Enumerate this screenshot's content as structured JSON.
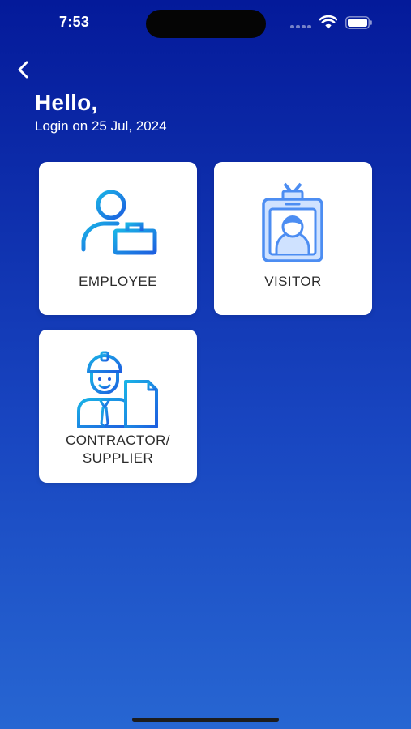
{
  "status_bar": {
    "time": "7:53",
    "icons": [
      "signal-icon",
      "wifi-icon",
      "battery-icon"
    ]
  },
  "header": {
    "back_icon": "chevron-left-icon",
    "greeting": "Hello,",
    "login_date": "Login on 25 Jul, 2024"
  },
  "cards": [
    {
      "label": "EMPLOYEE",
      "icon": "employee-id-icon"
    },
    {
      "label": "VISITOR",
      "icon": "visitor-badge-icon"
    },
    {
      "label": "CONTRACTOR/\nSUPPLIER",
      "icon": "contractor-worker-icon"
    }
  ],
  "colors": {
    "background_top": "#041a9a",
    "background_bottom": "#2766d2",
    "card_background": "#ffffff",
    "label_text": "#2b2b2b",
    "icon_gradient_start": "#1ab3e6",
    "icon_gradient_end": "#1d5fe0",
    "visitor_icon_blue": "#4c8df2",
    "visitor_icon_light": "#cfe2ff"
  }
}
